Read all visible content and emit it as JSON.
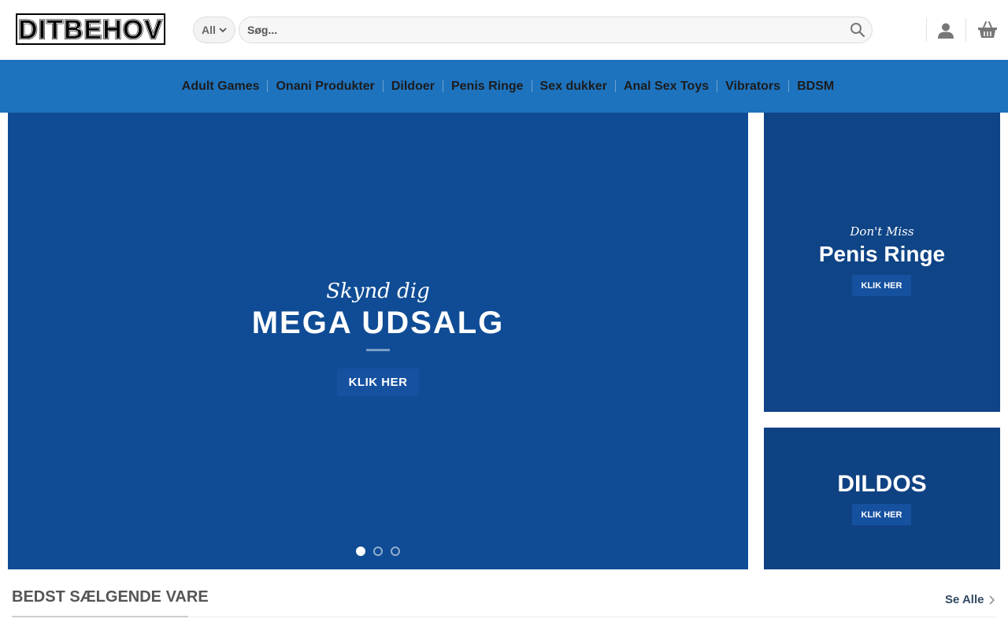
{
  "header": {
    "logo_text": "DITBEHOV",
    "category_select": "All",
    "search_placeholder": "Søg..."
  },
  "nav": {
    "items": [
      {
        "label": "Adult Games"
      },
      {
        "label": "Onani Produkter"
      },
      {
        "label": "Dildoer"
      },
      {
        "label": "Penis Ringe"
      },
      {
        "label": "Sex dukker"
      },
      {
        "label": "Anal Sex Toys"
      },
      {
        "label": "Vibrators"
      },
      {
        "label": "BDSM"
      }
    ]
  },
  "hero": {
    "tagline": "Skynd dig",
    "title": "MEGA UDSALG",
    "button": "KLIK HER",
    "slides": 3,
    "active_slide": 1
  },
  "side_banner_1": {
    "tagline": "Don't Miss",
    "title": "Penis Ringe",
    "button": "KLIK HER"
  },
  "side_banner_2": {
    "title": "DILDOS",
    "button": "KLIK HER"
  },
  "best_sellers": {
    "title": "BEDST SÆLGENDE VARE",
    "see_all": "Se Alle"
  },
  "colors": {
    "nav_bg": "#1e73be",
    "hero_bg": "#0f4c95",
    "banner_bg": "#0f4486",
    "button_bg": "#1651a0",
    "link": "#334862"
  },
  "icons": [
    "search-icon",
    "chevron-down-icon",
    "user-icon",
    "basket-icon",
    "chevron-right-icon"
  ]
}
